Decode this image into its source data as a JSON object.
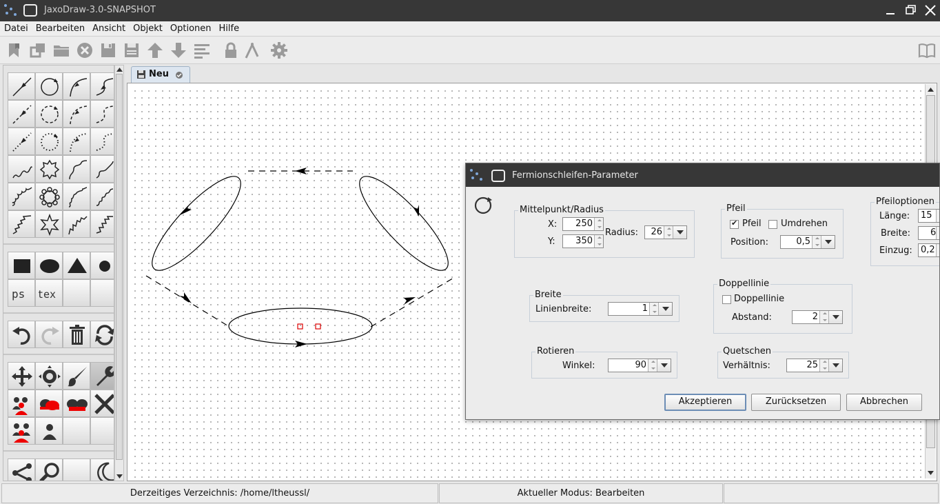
{
  "window": {
    "title": "JaxoDraw-3.0-SNAPSHOT"
  },
  "menu": [
    "Datei",
    "Bearbeiten",
    "Ansicht",
    "Objekt",
    "Optionen",
    "Hilfe"
  ],
  "tab": {
    "label": "Neu"
  },
  "status": {
    "directory": "Derzeitiges Verzeichnis: /home/ltheussl/",
    "mode": "Aktueller Modus: Bearbeiten",
    "extra": ""
  },
  "palette": {
    "text_buttons": [
      "ps",
      "tex"
    ]
  },
  "dialog": {
    "title": "Fermionschleifen-Parameter",
    "center_radius": {
      "title": "Mittelpunkt/Radius",
      "x_label": "X:",
      "x_value": "250",
      "y_label": "Y:",
      "y_value": "350",
      "radius_label": "Radius:",
      "radius_value": "26"
    },
    "arrow": {
      "title": "Pfeil",
      "arrow_label": "Pfeil",
      "arrow_checked": true,
      "flip_label": "Umdrehen",
      "flip_checked": false,
      "position_label": "Position:",
      "position_value": "0,5"
    },
    "arrow_options": {
      "title": "Pfeiloptionen",
      "length_label": "Länge:",
      "length_value": "15",
      "width_label": "Breite:",
      "width_value": "6",
      "inset_label": "Einzug:",
      "inset_value": "0,2"
    },
    "width": {
      "title": "Breite",
      "line_width_label": "Linienbreite:",
      "line_width_value": "1"
    },
    "double_line": {
      "title": "Doppellinie",
      "double_label": "Doppellinie",
      "double_checked": false,
      "spacing_label": "Abstand:",
      "spacing_value": "2"
    },
    "rotate": {
      "title": "Rotieren",
      "angle_label": "Winkel:",
      "angle_value": "90"
    },
    "squeeze": {
      "title": "Quetschen",
      "ratio_label": "Verhältnis:",
      "ratio_value": "25"
    },
    "buttons": {
      "accept": "Akzeptieren",
      "reset": "Zurücksetzen",
      "cancel": "Abbrechen"
    }
  }
}
